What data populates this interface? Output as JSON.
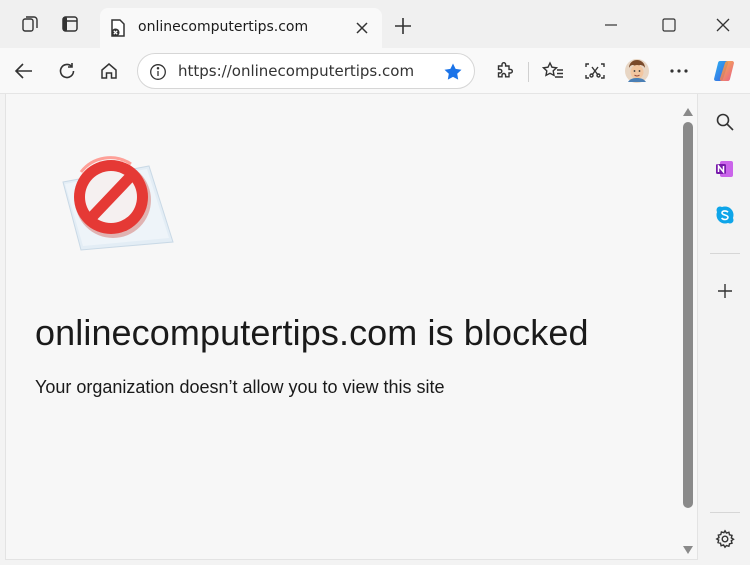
{
  "browser": {
    "tab": {
      "title": "onlinecomputertips.com"
    },
    "address_bar": {
      "url": "https://onlinecomputertips.com"
    }
  },
  "page": {
    "heading": "onlinecomputertips.com is blocked",
    "message": "Your organization doesn’t allow you to view this site"
  },
  "colors": {
    "accent": "#1a73e8",
    "block_red": "#e53935",
    "scroll_thumb": "#8a8a8a"
  },
  "icons": {
    "titlebar": [
      "workspaces-icon",
      "vertical-tabs-icon"
    ],
    "toolbar": [
      "back-icon",
      "refresh-icon",
      "home-icon",
      "extensions-icon",
      "favorites-icon",
      "web-capture-icon",
      "profile-avatar",
      "more-icon",
      "copilot-icon"
    ],
    "sidebar": [
      "search-icon",
      "onenote-icon",
      "skype-icon",
      "add-icon",
      "settings-icon"
    ]
  }
}
